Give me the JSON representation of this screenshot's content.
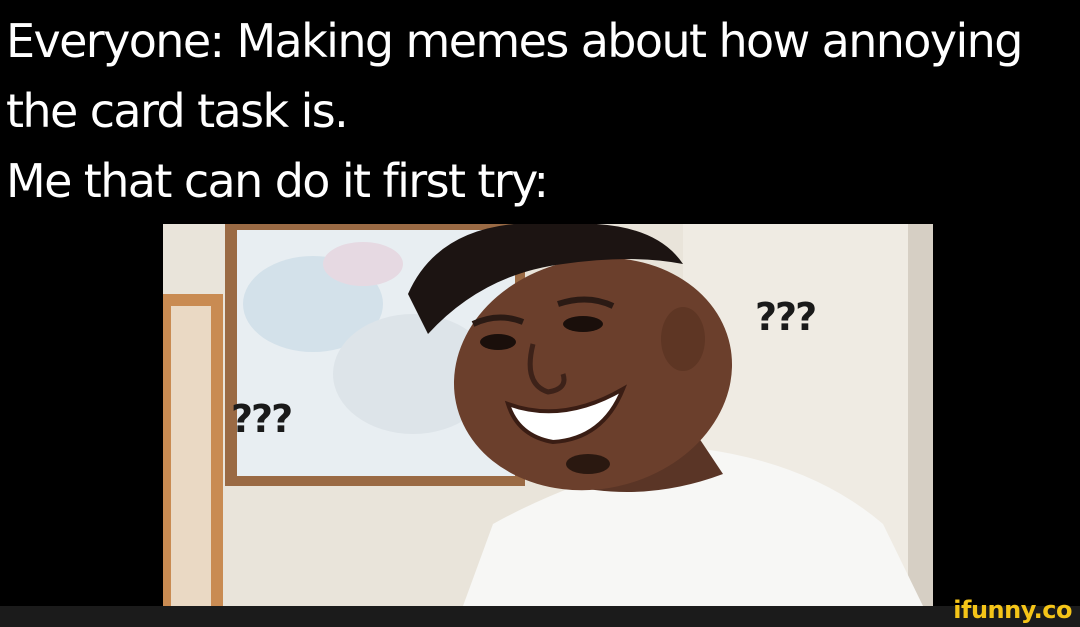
{
  "caption": {
    "line1": "Everyone: Making memes about how annoying",
    "line2": "the card task is.",
    "line3": "Me that can do it first try:"
  },
  "photo": {
    "question_marks_right": "???",
    "question_marks_left": "???"
  },
  "watermark": {
    "text": "ifunny.co"
  },
  "colors": {
    "background": "#000000",
    "caption_text": "#ffffff",
    "watermark": "#f5c518",
    "footer_bar": "#1b1b1b"
  }
}
